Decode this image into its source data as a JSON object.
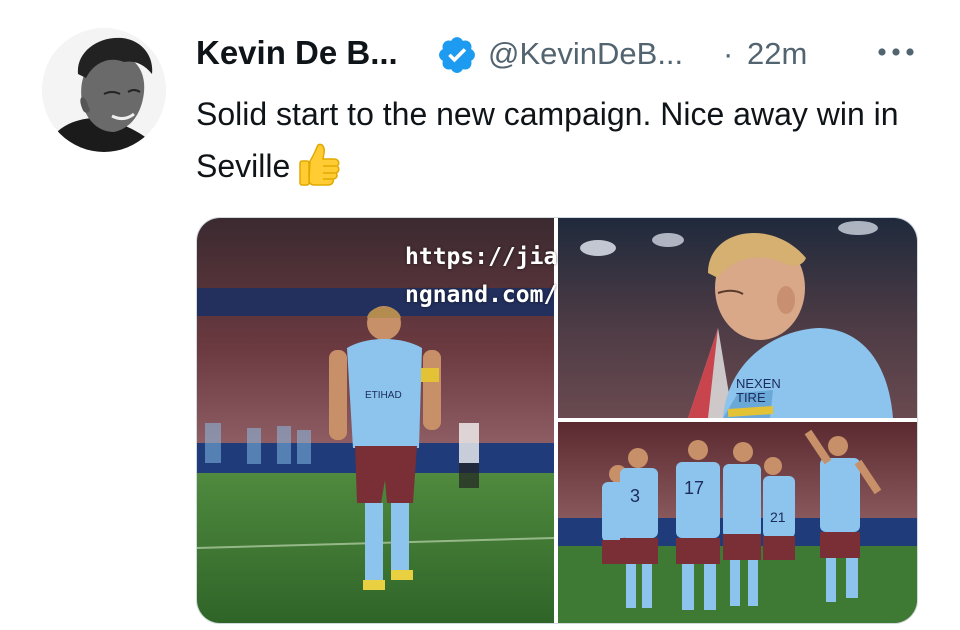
{
  "tweet": {
    "author_name": "Kevin De B...",
    "handle": "@KevinDeB...",
    "separator": "·",
    "time": "22m",
    "text": "Solid start to the new campaign. Nice away win in Seville",
    "emoji": "thumbs-up",
    "verified": true
  },
  "media": {
    "watermark": "https://jiangnand.com/",
    "photos": [
      {
        "name": "player-walking-photo",
        "kit_sponsor": "ETIHAD",
        "captain_band": true
      },
      {
        "name": "player-closeup-photo",
        "sponsor_text": "NEXEN TIRE"
      },
      {
        "name": "team-celebration-photo",
        "shirt_numbers": [
          "3",
          "17",
          "21"
        ]
      }
    ]
  },
  "colors": {
    "name": "#0f1419",
    "secondary": "#536471",
    "verified": "#1d9bf0",
    "sky_blue": "#8cc4ee",
    "claret": "#7a2e36"
  }
}
